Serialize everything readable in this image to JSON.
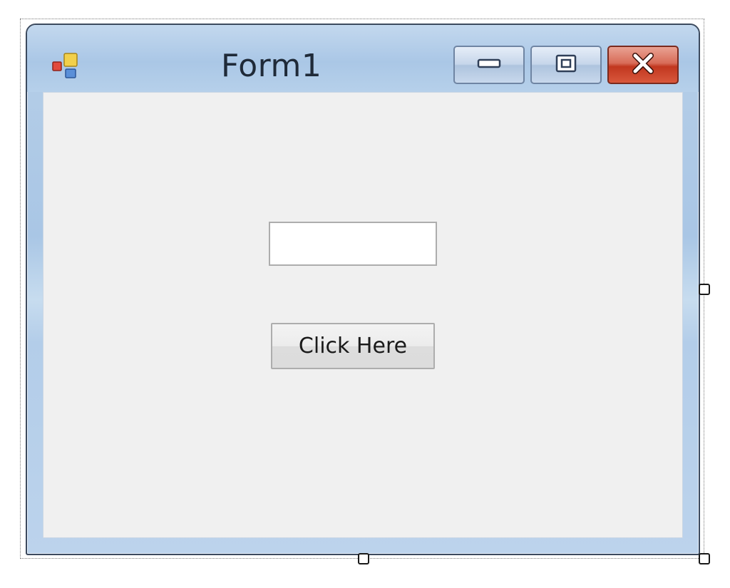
{
  "window": {
    "title": "Form1"
  },
  "caption_buttons": {
    "minimize_icon": "minimize-icon",
    "maximize_icon": "maximize-icon",
    "close_icon": "close-icon"
  },
  "form": {
    "textbox_value": "",
    "button_label": "Click Here"
  },
  "colors": {
    "client_background": "#f0f0f0",
    "frame": "#b7cfe8",
    "close_button": "#c1371f"
  }
}
